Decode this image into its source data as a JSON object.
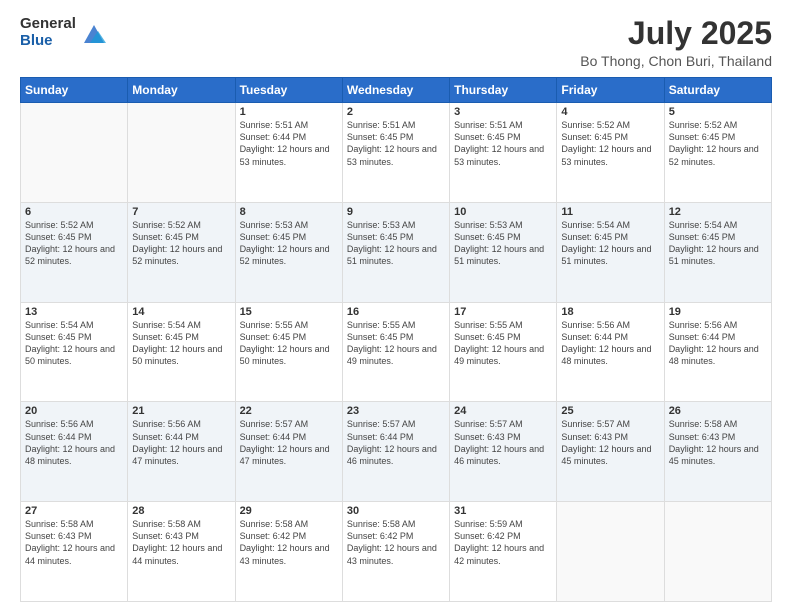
{
  "logo": {
    "general": "General",
    "blue": "Blue"
  },
  "title": "July 2025",
  "subtitle": "Bo Thong, Chon Buri, Thailand",
  "days_of_week": [
    "Sunday",
    "Monday",
    "Tuesday",
    "Wednesday",
    "Thursday",
    "Friday",
    "Saturday"
  ],
  "weeks": [
    [
      {
        "day": "",
        "sunrise": "",
        "sunset": "",
        "daylight": ""
      },
      {
        "day": "",
        "sunrise": "",
        "sunset": "",
        "daylight": ""
      },
      {
        "day": "1",
        "sunrise": "Sunrise: 5:51 AM",
        "sunset": "Sunset: 6:44 PM",
        "daylight": "Daylight: 12 hours and 53 minutes."
      },
      {
        "day": "2",
        "sunrise": "Sunrise: 5:51 AM",
        "sunset": "Sunset: 6:45 PM",
        "daylight": "Daylight: 12 hours and 53 minutes."
      },
      {
        "day": "3",
        "sunrise": "Sunrise: 5:51 AM",
        "sunset": "Sunset: 6:45 PM",
        "daylight": "Daylight: 12 hours and 53 minutes."
      },
      {
        "day": "4",
        "sunrise": "Sunrise: 5:52 AM",
        "sunset": "Sunset: 6:45 PM",
        "daylight": "Daylight: 12 hours and 53 minutes."
      },
      {
        "day": "5",
        "sunrise": "Sunrise: 5:52 AM",
        "sunset": "Sunset: 6:45 PM",
        "daylight": "Daylight: 12 hours and 52 minutes."
      }
    ],
    [
      {
        "day": "6",
        "sunrise": "Sunrise: 5:52 AM",
        "sunset": "Sunset: 6:45 PM",
        "daylight": "Daylight: 12 hours and 52 minutes."
      },
      {
        "day": "7",
        "sunrise": "Sunrise: 5:52 AM",
        "sunset": "Sunset: 6:45 PM",
        "daylight": "Daylight: 12 hours and 52 minutes."
      },
      {
        "day": "8",
        "sunrise": "Sunrise: 5:53 AM",
        "sunset": "Sunset: 6:45 PM",
        "daylight": "Daylight: 12 hours and 52 minutes."
      },
      {
        "day": "9",
        "sunrise": "Sunrise: 5:53 AM",
        "sunset": "Sunset: 6:45 PM",
        "daylight": "Daylight: 12 hours and 51 minutes."
      },
      {
        "day": "10",
        "sunrise": "Sunrise: 5:53 AM",
        "sunset": "Sunset: 6:45 PM",
        "daylight": "Daylight: 12 hours and 51 minutes."
      },
      {
        "day": "11",
        "sunrise": "Sunrise: 5:54 AM",
        "sunset": "Sunset: 6:45 PM",
        "daylight": "Daylight: 12 hours and 51 minutes."
      },
      {
        "day": "12",
        "sunrise": "Sunrise: 5:54 AM",
        "sunset": "Sunset: 6:45 PM",
        "daylight": "Daylight: 12 hours and 51 minutes."
      }
    ],
    [
      {
        "day": "13",
        "sunrise": "Sunrise: 5:54 AM",
        "sunset": "Sunset: 6:45 PM",
        "daylight": "Daylight: 12 hours and 50 minutes."
      },
      {
        "day": "14",
        "sunrise": "Sunrise: 5:54 AM",
        "sunset": "Sunset: 6:45 PM",
        "daylight": "Daylight: 12 hours and 50 minutes."
      },
      {
        "day": "15",
        "sunrise": "Sunrise: 5:55 AM",
        "sunset": "Sunset: 6:45 PM",
        "daylight": "Daylight: 12 hours and 50 minutes."
      },
      {
        "day": "16",
        "sunrise": "Sunrise: 5:55 AM",
        "sunset": "Sunset: 6:45 PM",
        "daylight": "Daylight: 12 hours and 49 minutes."
      },
      {
        "day": "17",
        "sunrise": "Sunrise: 5:55 AM",
        "sunset": "Sunset: 6:45 PM",
        "daylight": "Daylight: 12 hours and 49 minutes."
      },
      {
        "day": "18",
        "sunrise": "Sunrise: 5:56 AM",
        "sunset": "Sunset: 6:44 PM",
        "daylight": "Daylight: 12 hours and 48 minutes."
      },
      {
        "day": "19",
        "sunrise": "Sunrise: 5:56 AM",
        "sunset": "Sunset: 6:44 PM",
        "daylight": "Daylight: 12 hours and 48 minutes."
      }
    ],
    [
      {
        "day": "20",
        "sunrise": "Sunrise: 5:56 AM",
        "sunset": "Sunset: 6:44 PM",
        "daylight": "Daylight: 12 hours and 48 minutes."
      },
      {
        "day": "21",
        "sunrise": "Sunrise: 5:56 AM",
        "sunset": "Sunset: 6:44 PM",
        "daylight": "Daylight: 12 hours and 47 minutes."
      },
      {
        "day": "22",
        "sunrise": "Sunrise: 5:57 AM",
        "sunset": "Sunset: 6:44 PM",
        "daylight": "Daylight: 12 hours and 47 minutes."
      },
      {
        "day": "23",
        "sunrise": "Sunrise: 5:57 AM",
        "sunset": "Sunset: 6:44 PM",
        "daylight": "Daylight: 12 hours and 46 minutes."
      },
      {
        "day": "24",
        "sunrise": "Sunrise: 5:57 AM",
        "sunset": "Sunset: 6:43 PM",
        "daylight": "Daylight: 12 hours and 46 minutes."
      },
      {
        "day": "25",
        "sunrise": "Sunrise: 5:57 AM",
        "sunset": "Sunset: 6:43 PM",
        "daylight": "Daylight: 12 hours and 45 minutes."
      },
      {
        "day": "26",
        "sunrise": "Sunrise: 5:58 AM",
        "sunset": "Sunset: 6:43 PM",
        "daylight": "Daylight: 12 hours and 45 minutes."
      }
    ],
    [
      {
        "day": "27",
        "sunrise": "Sunrise: 5:58 AM",
        "sunset": "Sunset: 6:43 PM",
        "daylight": "Daylight: 12 hours and 44 minutes."
      },
      {
        "day": "28",
        "sunrise": "Sunrise: 5:58 AM",
        "sunset": "Sunset: 6:43 PM",
        "daylight": "Daylight: 12 hours and 44 minutes."
      },
      {
        "day": "29",
        "sunrise": "Sunrise: 5:58 AM",
        "sunset": "Sunset: 6:42 PM",
        "daylight": "Daylight: 12 hours and 43 minutes."
      },
      {
        "day": "30",
        "sunrise": "Sunrise: 5:58 AM",
        "sunset": "Sunset: 6:42 PM",
        "daylight": "Daylight: 12 hours and 43 minutes."
      },
      {
        "day": "31",
        "sunrise": "Sunrise: 5:59 AM",
        "sunset": "Sunset: 6:42 PM",
        "daylight": "Daylight: 12 hours and 42 minutes."
      },
      {
        "day": "",
        "sunrise": "",
        "sunset": "",
        "daylight": ""
      },
      {
        "day": "",
        "sunrise": "",
        "sunset": "",
        "daylight": ""
      }
    ]
  ]
}
